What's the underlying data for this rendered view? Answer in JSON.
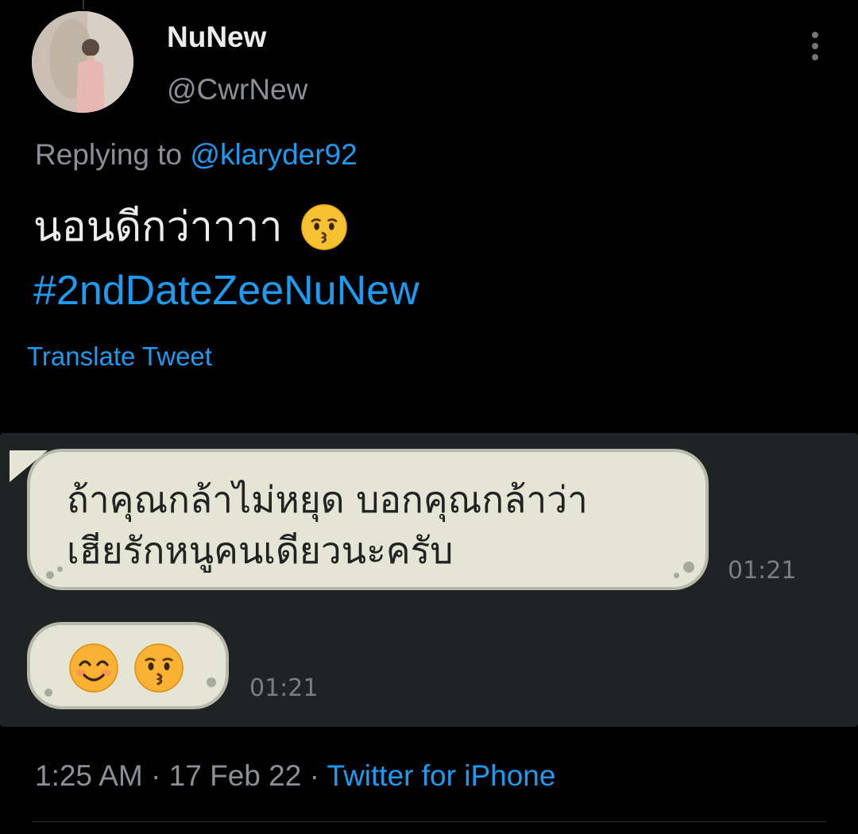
{
  "tweet": {
    "display_name": "NuNew",
    "handle": "@CwrNew",
    "replying_prefix": "Replying to",
    "replying_to": "@klaryder92",
    "text_line1": "นอนดีกว่าาาา",
    "hashtag": "#2ndDateZeeNuNew",
    "translate_label": "Translate Tweet",
    "time": "1:25 AM",
    "date": "17 Feb 22",
    "source": "Twitter for iPhone",
    "meta_separator": "·",
    "emoji": "kissing-face-emoji",
    "more_icon": "more-vertical-icon",
    "accent_color": "#1d9bf0"
  },
  "media": {
    "message1_line1": "ถ้าคุณกล้าไม่หยุด บอกคุณกล้าว่า",
    "message1_line2": "เฮียรักหนูคนเดียวนะครับ",
    "message1_time": "01:21",
    "message2_emojis": [
      "smiling-face-emoji",
      "kissing-face-emoji"
    ],
    "message2_time": "01:21",
    "bubble_color": "#e4e5d5"
  }
}
